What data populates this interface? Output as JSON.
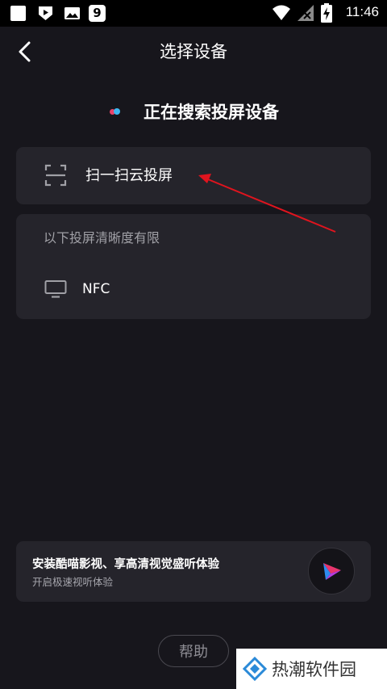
{
  "status_bar": {
    "time": "11:46",
    "left_icons": [
      "square-notification-icon",
      "play-notification-icon",
      "image-notification-icon",
      "app-9-notification-icon"
    ],
    "right_icons": [
      "wifi-icon",
      "no-signal-icon",
      "battery-charging-icon"
    ],
    "app_icon_glyph": "9"
  },
  "header": {
    "title": "选择设备",
    "back_icon": "chevron-left-icon"
  },
  "searching": {
    "text": "正在搜索投屏设备"
  },
  "scan_card": {
    "label": "扫一扫云投屏",
    "icon": "scan-icon"
  },
  "device_list": {
    "notice": "以下投屏清晰度有限",
    "devices": [
      {
        "name": "NFC",
        "icon": "tv-icon"
      }
    ]
  },
  "promo": {
    "title": "安装酷喵影视、享高清视觉盛听体验",
    "subtitle": "开启极速视听体验",
    "logo_icon": "kumiao-logo-icon"
  },
  "help": {
    "label": "帮助"
  },
  "watermark": {
    "text": "热潮软件园",
    "icon": "diamond-logo-icon"
  },
  "colors": {
    "background": "#17161c",
    "card": "#25242b",
    "arrow": "#e0141e",
    "text_secondary": "#a0a0a6"
  }
}
